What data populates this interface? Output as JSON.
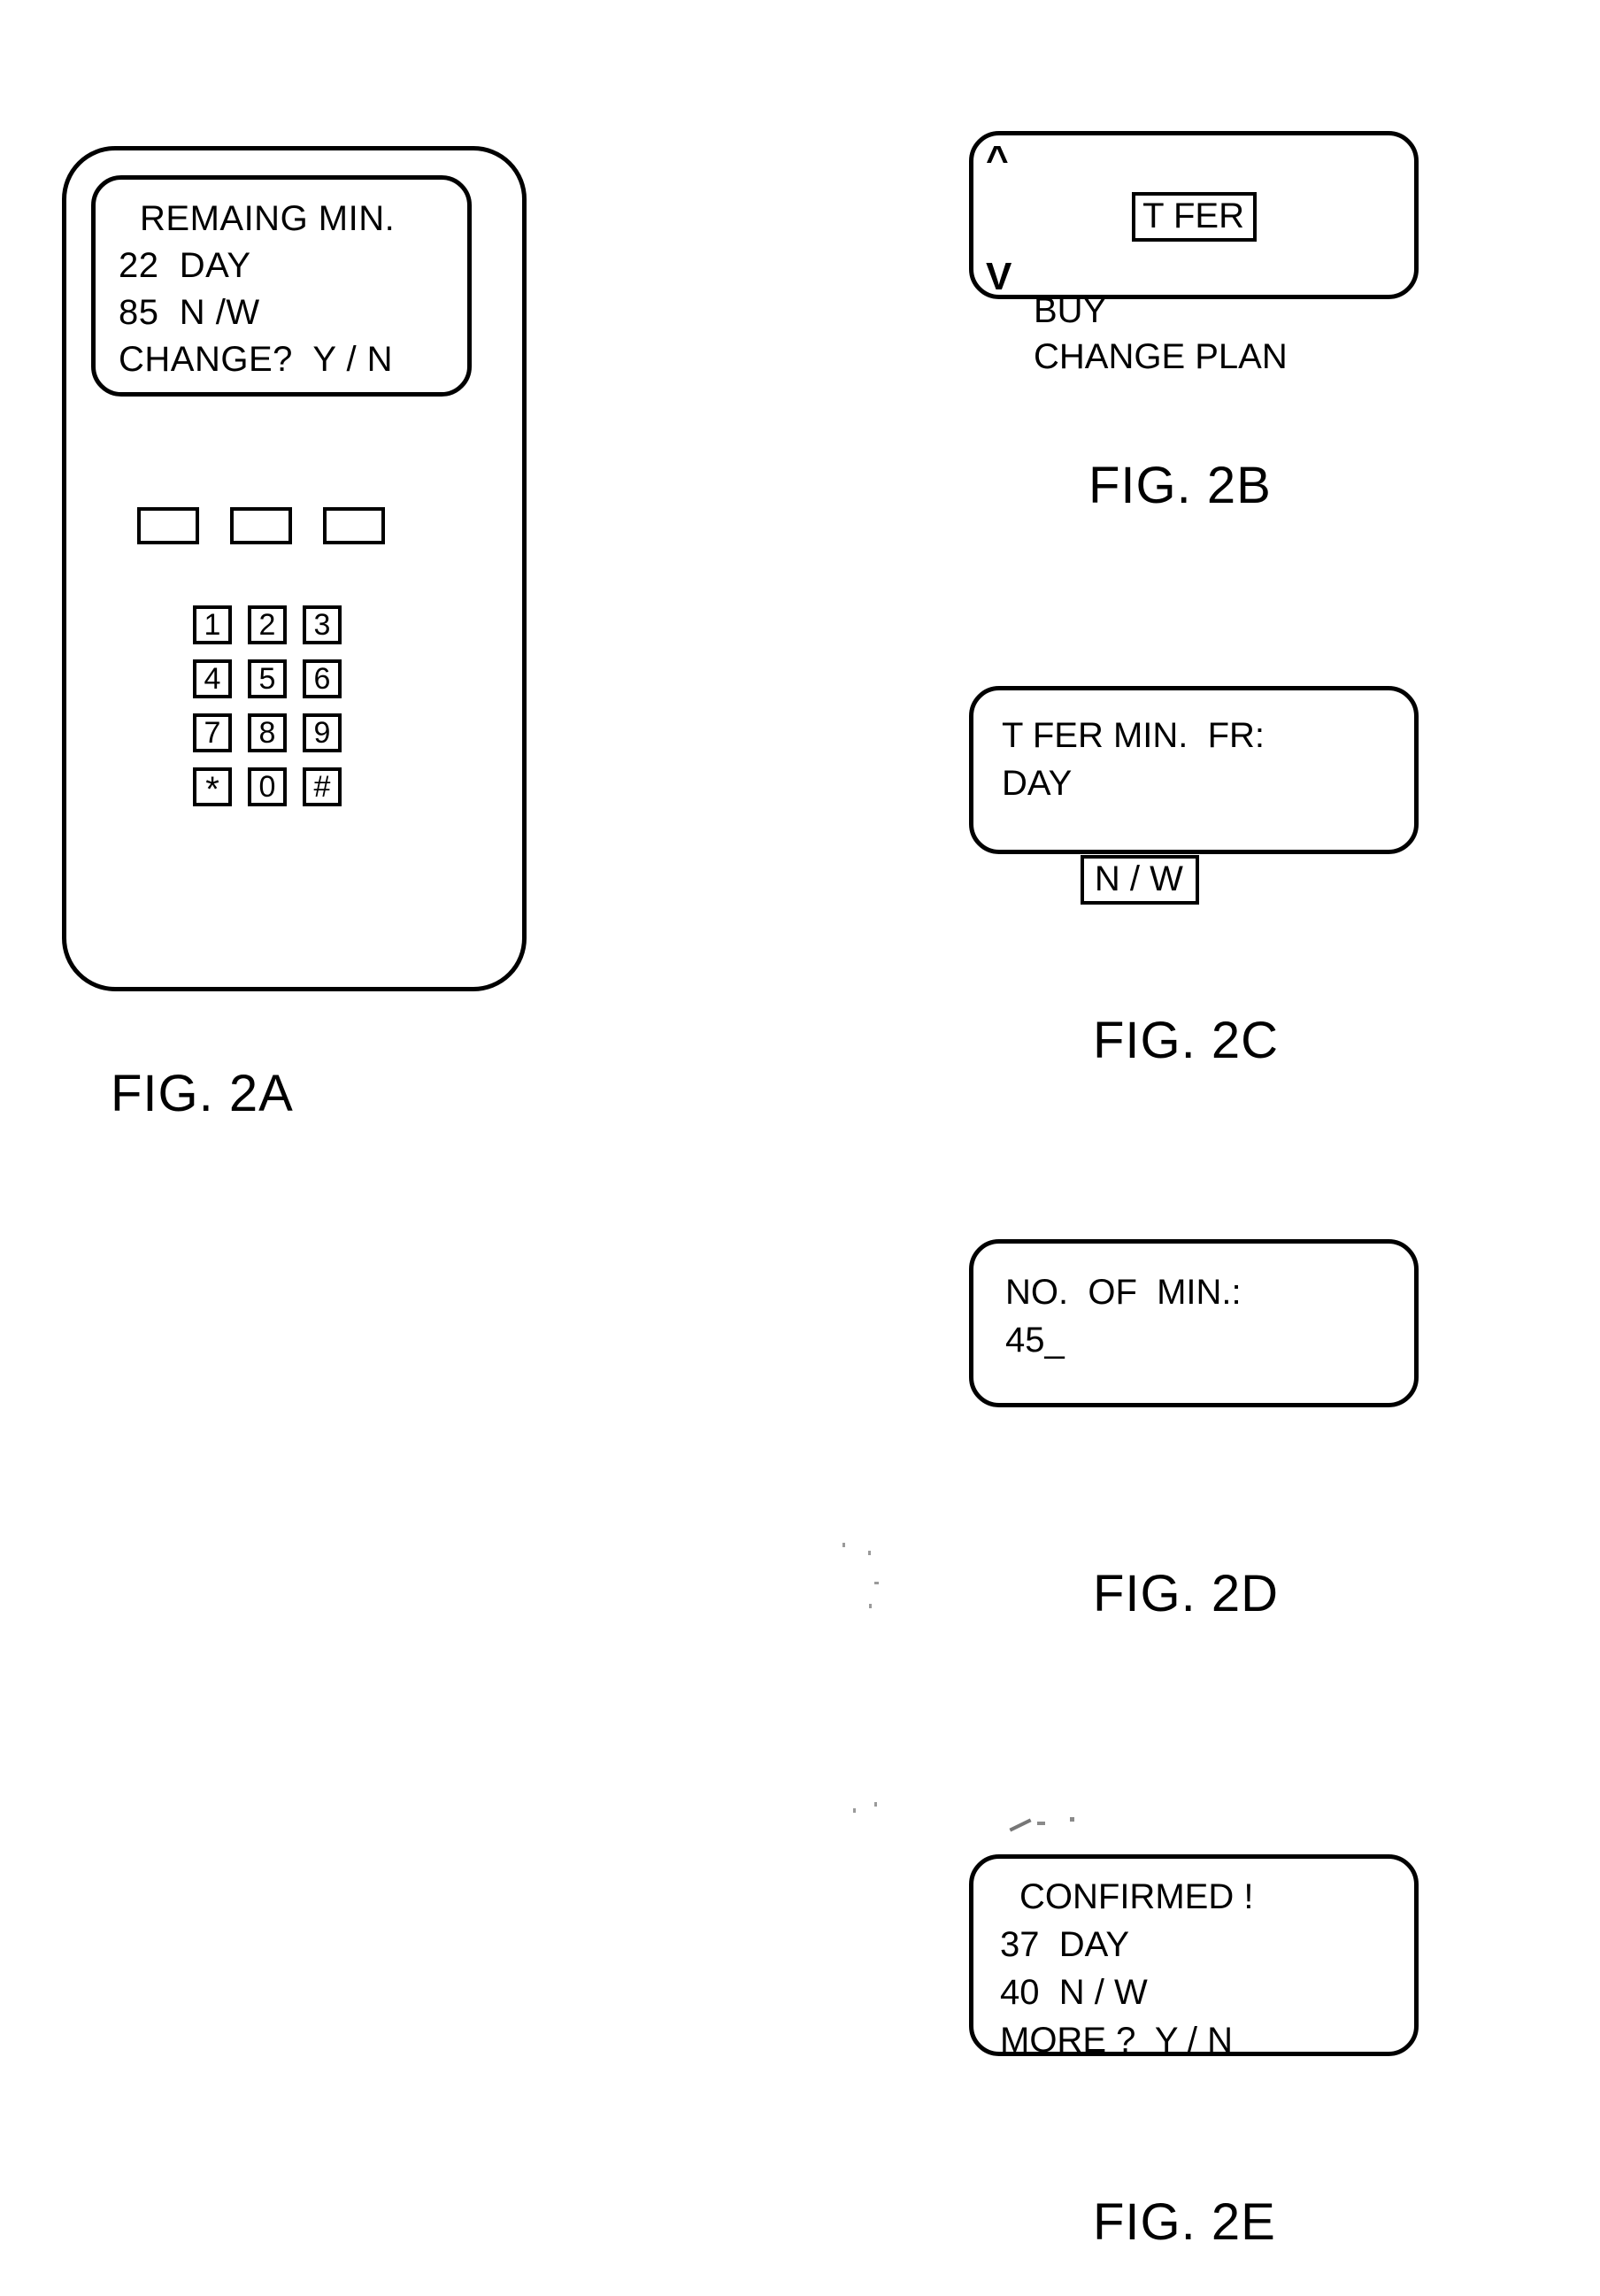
{
  "figure": {
    "sheet_label": "FIG. 2",
    "panels": [
      "FIG. 2A",
      "FIG. 2B",
      "FIG. 2C",
      "FIG. 2D",
      "FIG. 2E"
    ]
  },
  "fig2a": {
    "caption": "FIG. 2A",
    "device": "mobile handset",
    "screen": {
      "lines": [
        "REMAING MIN.",
        "22  DAY",
        "85  N /W",
        "CHANGE?  Y / N"
      ]
    },
    "softkeys": [
      {
        "label": ""
      },
      {
        "label": ""
      },
      {
        "label": ""
      }
    ],
    "keypad": {
      "rows": [
        [
          "1",
          "2",
          "3"
        ],
        [
          "4",
          "5",
          "6"
        ],
        [
          "7",
          "8",
          "9"
        ],
        [
          "*",
          "0",
          "#"
        ]
      ]
    }
  },
  "fig2b": {
    "caption": "FIG. 2B",
    "scroll_up_icon": "^",
    "scroll_down_icon": "V",
    "menu": [
      {
        "label": "T FER",
        "selected": true
      },
      {
        "label": "BUY",
        "selected": false
      },
      {
        "label": "CHANGE PLAN",
        "selected": false
      }
    ]
  },
  "fig2c": {
    "caption": "FIG. 2C",
    "lines": [
      "T FER MIN.  FR:",
      "DAY"
    ],
    "boxed_value": "N / W"
  },
  "fig2d": {
    "caption": "FIG. 2D",
    "lines": [
      "NO.  OF  MIN.:",
      "45_"
    ]
  },
  "fig2e": {
    "caption": "FIG. 2E",
    "lines": [
      "CONFIRMED !",
      "37  DAY",
      "40  N / W",
      "MORE ?  Y / N"
    ]
  },
  "colors": {
    "ink": "#000000",
    "paper": "#ffffff"
  }
}
